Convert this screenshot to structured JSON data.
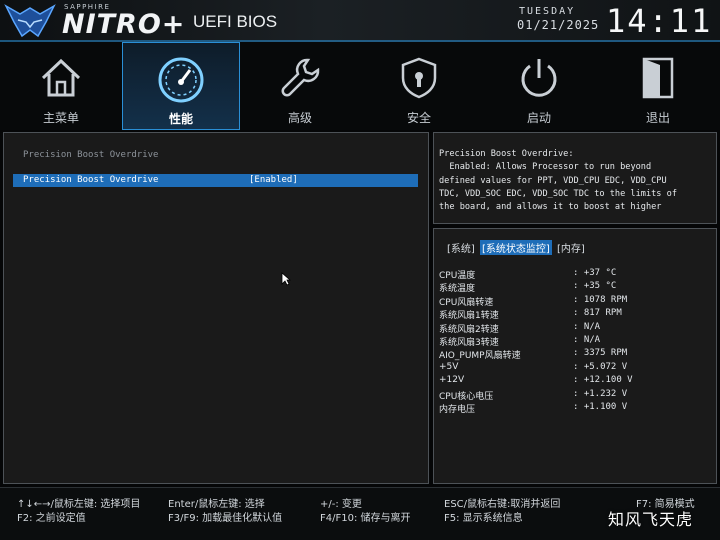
{
  "header": {
    "brand_sub": "SAPPHIRE",
    "brand_main": "NITRO+",
    "app_title": "UEFI BIOS",
    "weekday": "TUESDAY",
    "date": "01/21/2025",
    "time": "14:11"
  },
  "nav": {
    "tabs": [
      {
        "label": "主菜单",
        "icon": "home-icon"
      },
      {
        "label": "性能",
        "icon": "speedometer-icon",
        "active": true
      },
      {
        "label": "高级",
        "icon": "wrench-icon"
      },
      {
        "label": "安全",
        "icon": "shield-lock-icon"
      },
      {
        "label": "启动",
        "icon": "power-icon"
      },
      {
        "label": "退出",
        "icon": "exit-door-icon"
      }
    ]
  },
  "main": {
    "section_title": "Precision Boost Overdrive",
    "rows": [
      {
        "label": "Precision Boost Overdrive",
        "value": "[Enabled]"
      }
    ]
  },
  "help": {
    "text": "Precision Boost Overdrive:\n  Enabled: Allows Processor to run beyond\ndefined values for PPT, VDD_CPU EDC, VDD_CPU\nTDC, VDD_SOC EDC, VDD_SOC TDC to the limits of\nthe board, and allows it to boost at higher"
  },
  "monitor": {
    "tabs": [
      "[系统]",
      "[系统状态监控]",
      "[内存]"
    ],
    "rows": [
      {
        "label": "CPU温度",
        "value": ": +37 °C"
      },
      {
        "label": "系统温度",
        "value": ": +35 °C"
      },
      {
        "label": "CPU风扇转速",
        "value": ": 1078 RPM"
      },
      {
        "label": "系统风扇1转速",
        "value": ": 817 RPM"
      },
      {
        "label": "系统风扇2转速",
        "value": ": N/A"
      },
      {
        "label": "系统风扇3转速",
        "value": ": N/A"
      },
      {
        "label": "AIO_PUMP风扇转速",
        "value": ": 3375 RPM"
      },
      {
        "label": "+5V",
        "value": ": +5.072 V"
      },
      {
        "label": "+12V",
        "value": ": +12.100 V"
      },
      {
        "label": "CPU核心电压",
        "value": ": +1.232 V"
      },
      {
        "label": "内存电压",
        "value": ": +1.100 V"
      }
    ]
  },
  "footer": {
    "hints": [
      "↑↓←→/鼠标左键: 选择项目",
      "F2: 之前设定值",
      "Enter/鼠标左键: 选择",
      "F3/F9: 加载最佳化默认值",
      "+/-: 变更",
      "F4/F10: 储存与离开",
      "ESC/鼠标右键:取消并返回",
      "F5: 显示系统信息",
      "F7: 简易模式"
    ],
    "watermark": "知风飞天虎"
  },
  "colors": {
    "accent": "#1e6db8",
    "tab_border": "#2a8fd6",
    "panel_bg": "#1a1a1a"
  }
}
